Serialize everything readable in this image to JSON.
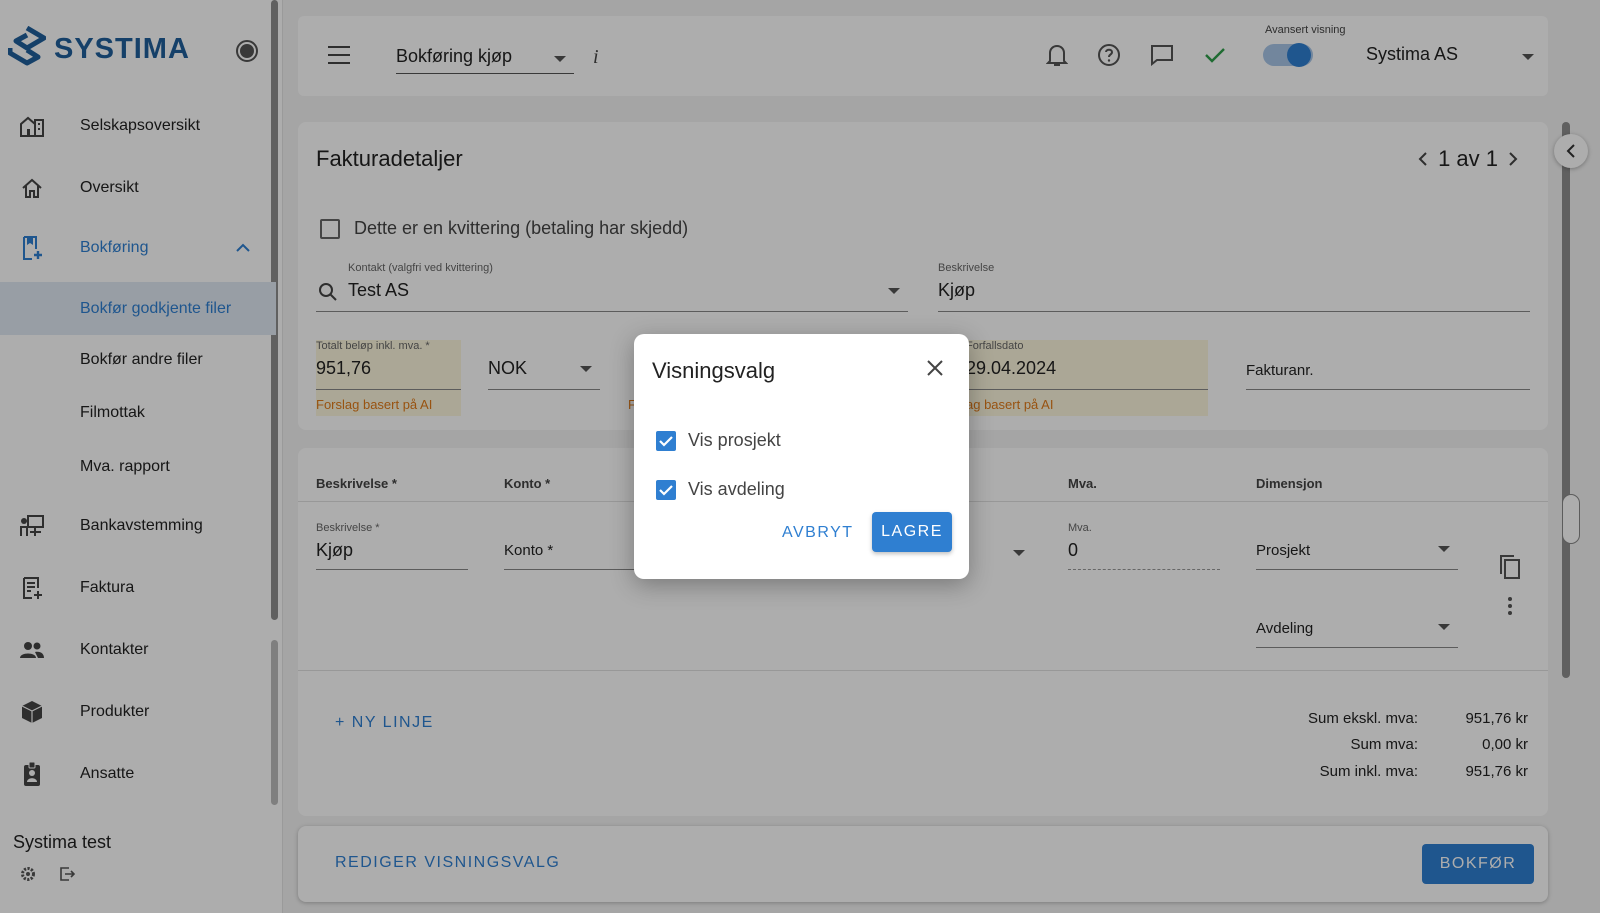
{
  "sidebar": {
    "logo_text": "SYSTIMA",
    "items": [
      {
        "label": "Selskapsoversikt",
        "icon": "company-overview-icon"
      },
      {
        "label": "Oversikt",
        "icon": "home-icon"
      },
      {
        "label": "Bokføring",
        "icon": "bookkeeping-icon"
      },
      {
        "label": "Bokfør godkjente filer"
      },
      {
        "label": "Bokfør andre filer"
      },
      {
        "label": "Filmottak"
      },
      {
        "label": "Mva. rapport"
      },
      {
        "label": "Bankavstemming",
        "icon": "bank-reconciliation-icon"
      },
      {
        "label": "Faktura",
        "icon": "invoice-icon"
      },
      {
        "label": "Kontakter",
        "icon": "contacts-icon"
      },
      {
        "label": "Produkter",
        "icon": "product-box-icon"
      },
      {
        "label": "Ansatte",
        "icon": "employee-badge-icon"
      }
    ],
    "company_name": "Systima test"
  },
  "topbar": {
    "page_select": "Bokføring kjøp",
    "info": "i",
    "advanced_label": "Avansert visning",
    "company": "Systima AS"
  },
  "invoice": {
    "title": "Fakturadetaljer",
    "pager": "1 av 1",
    "receipt_checkbox": "Dette er en kvittering (betaling har skjedd)",
    "contact_label": "Kontakt (valgfri ved kvittering)",
    "contact_value": "Test AS",
    "description_label": "Beskrivelse",
    "description_value": "Kjøp",
    "total_label": "Totalt beløp inkl. mva. *",
    "total_value": "951,76",
    "ai_hint": "Forslag basert på AI",
    "currency": "NOK",
    "due_label": "Forfallsdato",
    "due_value": "29.04.2024",
    "ai_hint_due": "ag basert på AI",
    "ai_hint_clip": "F",
    "invoice_no_placeholder": "Fakturanr."
  },
  "lines": {
    "headers": {
      "description": "Beskrivelse *",
      "account": "Konto *",
      "vat": "Mva.",
      "dimension": "Dimensjon"
    },
    "row": {
      "description_label": "Beskrivelse *",
      "description_value": "Kjøp",
      "account_placeholder": "Konto *",
      "vat_label": "Mva.",
      "vat_value": "0",
      "project_placeholder": "Prosjekt",
      "department_placeholder": "Avdeling"
    },
    "new_line": "+ NY LINJE",
    "sums": [
      {
        "label": "Sum ekskl. mva:",
        "value": "951,76 kr"
      },
      {
        "label": "Sum mva:",
        "value": "0,00 kr"
      },
      {
        "label": "Sum inkl. mva:",
        "value": "951,76 kr"
      }
    ]
  },
  "footer": {
    "edit_view": "REDIGER VISNINGSVALG",
    "book": "BOKFØR"
  },
  "dialog": {
    "title": "Visningsvalg",
    "options": [
      {
        "label": "Vis prosjekt",
        "checked": true
      },
      {
        "label": "Vis avdeling",
        "checked": true
      }
    ],
    "cancel": "AVBRYT",
    "save": "LAGRE"
  },
  "colors": {
    "primary": "#2f7fd1",
    "ai_hint": "#e07b1a",
    "ai_field_bg": "#fdf6dd",
    "success": "#2e9e4a"
  }
}
